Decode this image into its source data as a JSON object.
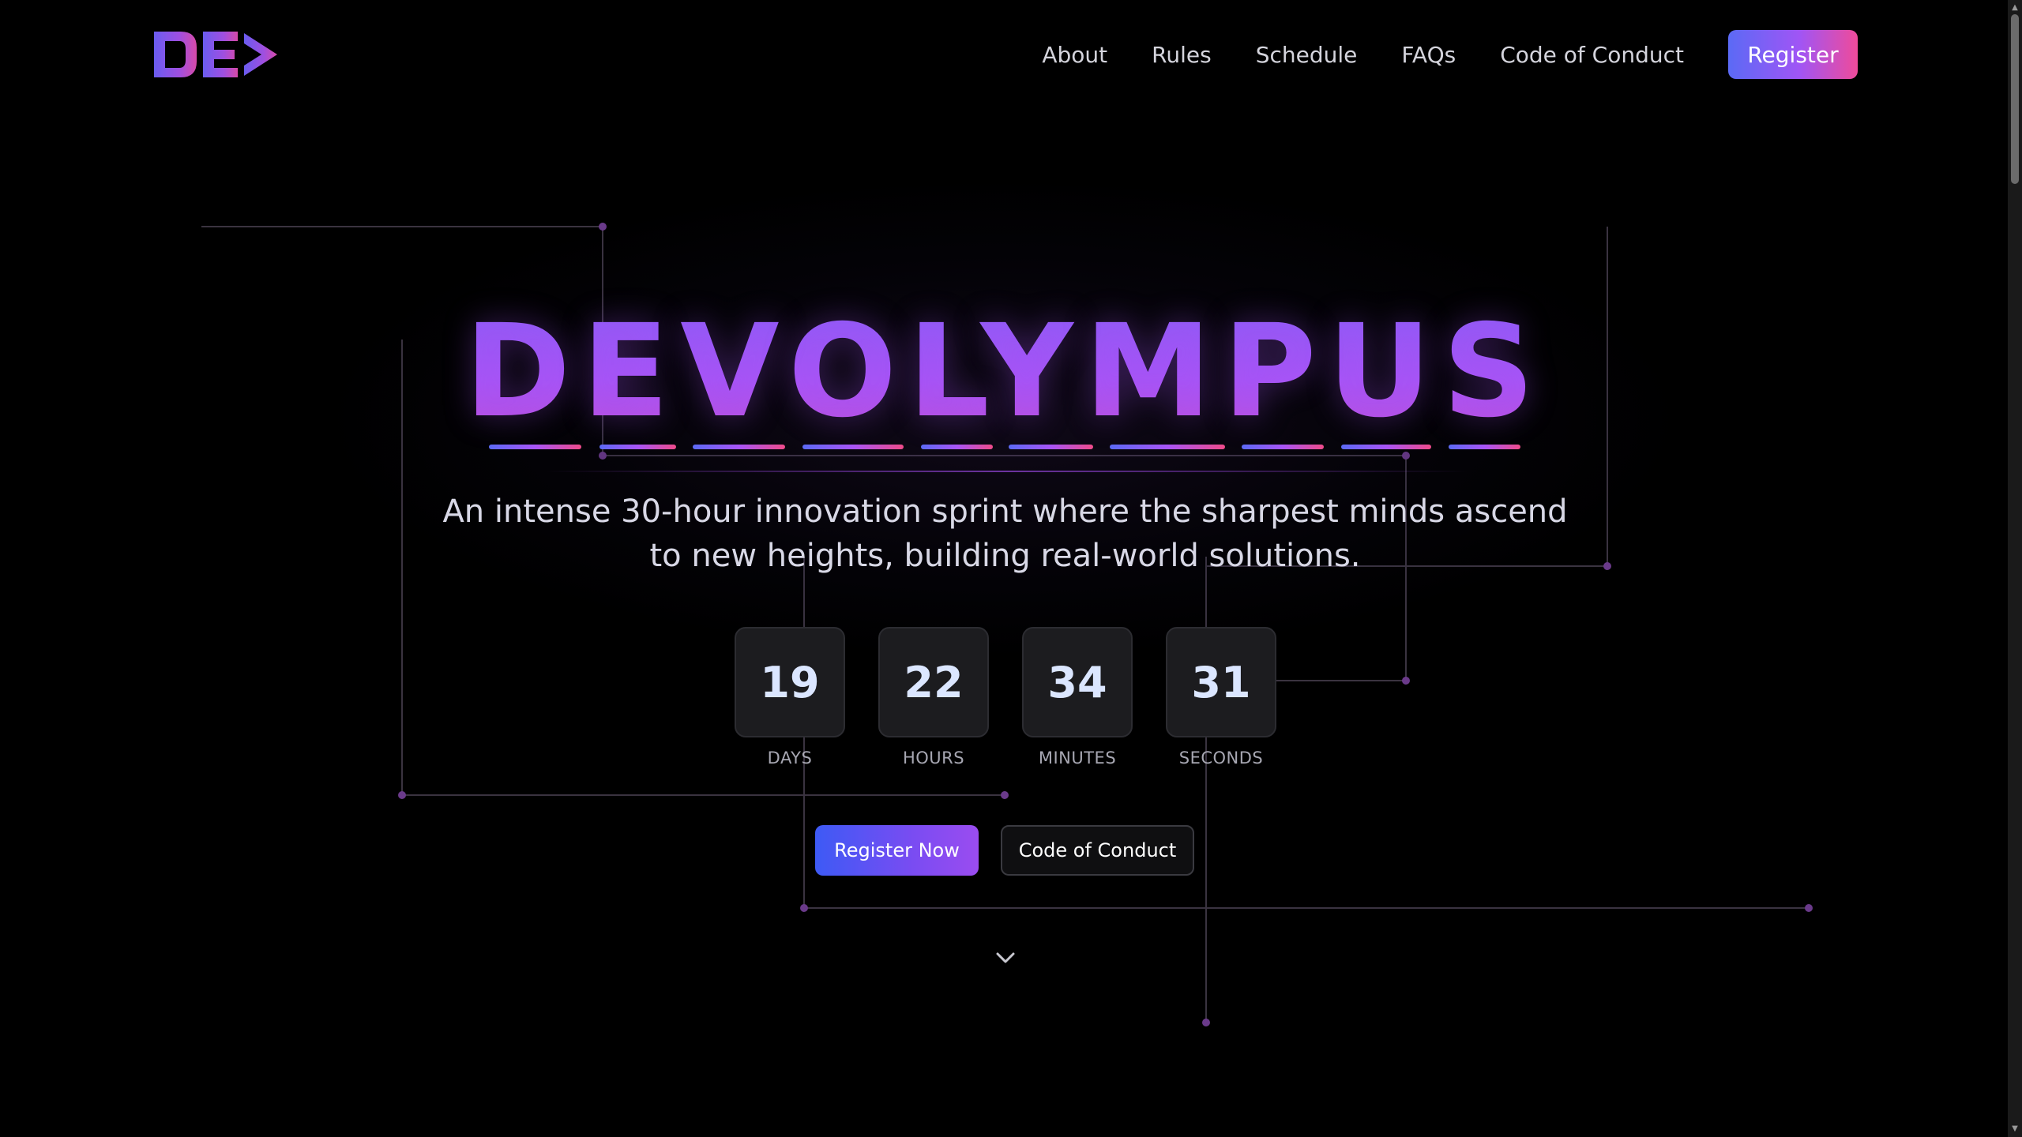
{
  "nav": {
    "logo_text": "DE>",
    "links": [
      "About",
      "Rules",
      "Schedule",
      "FAQs",
      "Code of Conduct"
    ],
    "register_label": "Register"
  },
  "hero": {
    "title": "DEVOLYMPUS",
    "subtitle": "An intense 30-hour innovation sprint where the sharpest minds ascend to new heights, building real-world solutions.",
    "countdown": [
      {
        "value": "19",
        "label": "DAYS"
      },
      {
        "value": "22",
        "label": "HOURS"
      },
      {
        "value": "34",
        "label": "MINUTES"
      },
      {
        "value": "31",
        "label": "SECONDS"
      }
    ],
    "primary_cta": "Register Now",
    "secondary_cta": "Code of Conduct",
    "scroll_icon": "chevron-down-icon"
  },
  "colors": {
    "background": "#000000",
    "accent_blue": "#5b6af5",
    "accent_purple": "#a855f7",
    "accent_pink": "#ef4b9a"
  }
}
